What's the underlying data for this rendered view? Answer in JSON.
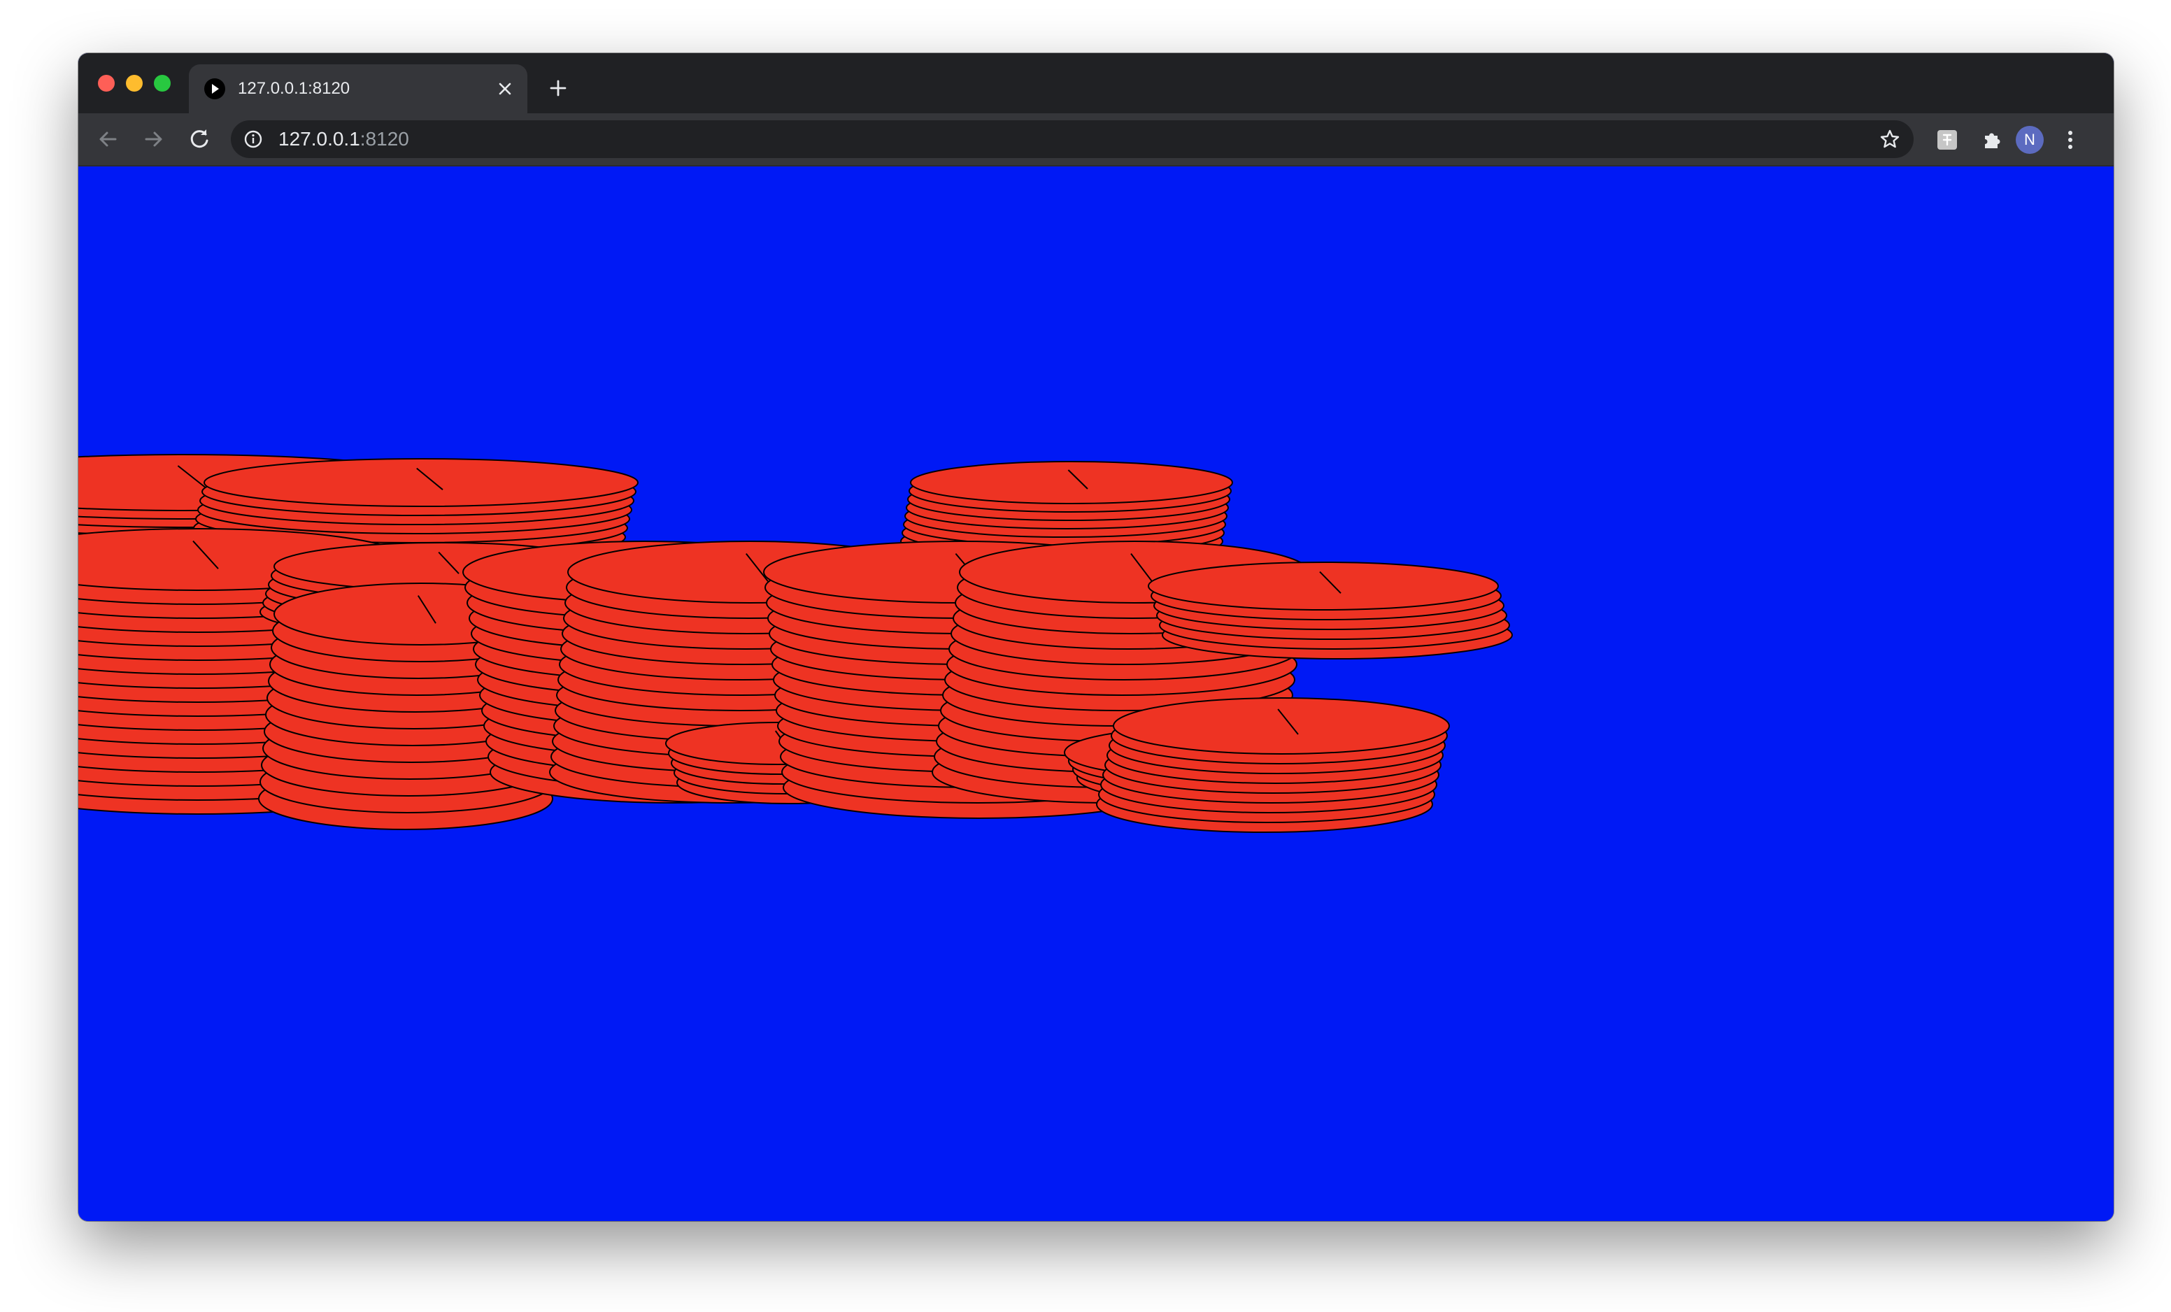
{
  "browser": {
    "tab": {
      "title": "127.0.0.1:8120",
      "favicon": "play-icon"
    },
    "address_bar": {
      "host": "127.0.0.1",
      "port": ":8120"
    },
    "profile_initial": "N",
    "icons": [
      "back-arrow-icon",
      "forward-arrow-icon",
      "reload-icon",
      "info-icon",
      "star-icon",
      "extension-icon",
      "puzzle-icon",
      "kebab-menu-icon"
    ]
  },
  "page": {
    "background_color": "#0019f5",
    "shape_fill": "#ee3323",
    "shape_stroke": "#000000",
    "content": "stacks of red elliptical discs"
  }
}
